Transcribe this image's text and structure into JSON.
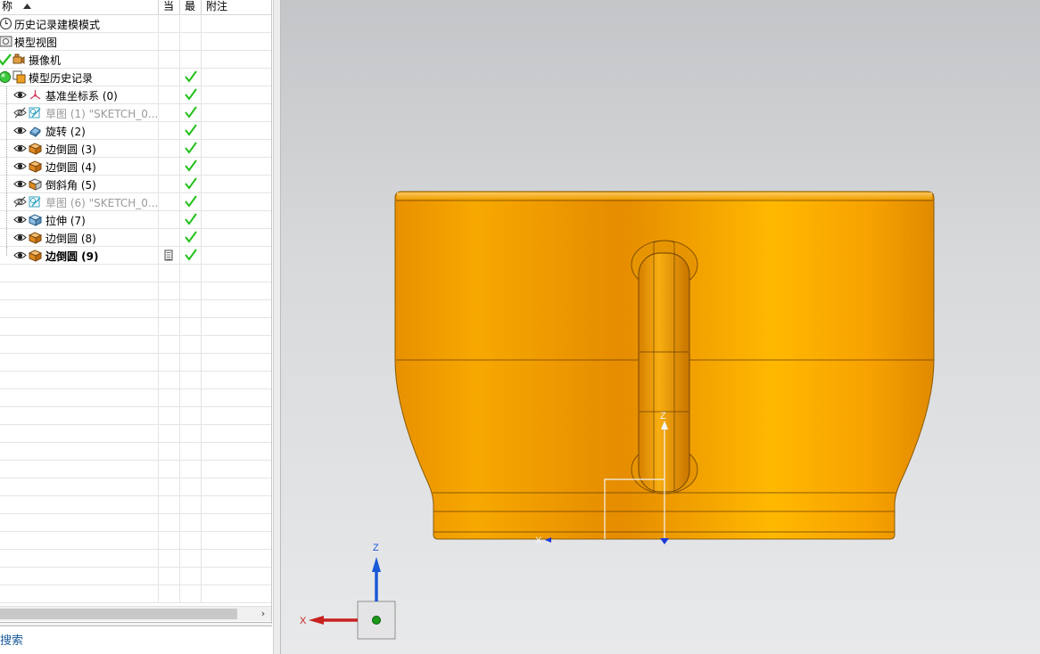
{
  "navigator": {
    "columns": {
      "name": "称",
      "current": "当",
      "latest": "最",
      "notes": "附注"
    },
    "rows": [
      {
        "label": "历史记录建模模式",
        "icon": "clock-icon"
      },
      {
        "label": "模型视图",
        "icon": "model-view-icon"
      },
      {
        "label": "摄像机",
        "icon": "camera-icon"
      },
      {
        "label": "模型历史记录",
        "icon": "history-folder-icon"
      },
      {
        "label": "基准坐标系 (0)",
        "icon": "datum-csys-icon"
      },
      {
        "label": "草图 (1) \"SKETCH_0...",
        "icon": "sketch-icon"
      },
      {
        "label": "旋转 (2)",
        "icon": "revolve-icon"
      },
      {
        "label": "边倒圆 (3)",
        "icon": "edge-blend-icon"
      },
      {
        "label": "边倒圆 (4)",
        "icon": "edge-blend-icon"
      },
      {
        "label": "倒斜角 (5)",
        "icon": "chamfer-icon"
      },
      {
        "label": "草图 (6) \"SKETCH_0...",
        "icon": "sketch-icon"
      },
      {
        "label": "拉伸 (7)",
        "icon": "extrude-icon"
      },
      {
        "label": "边倒圆 (8)",
        "icon": "edge-blend-icon"
      },
      {
        "label": "边倒圆 (9)",
        "icon": "edge-blend-icon"
      }
    ],
    "search_label": "搜索",
    "scroll_right": "›"
  },
  "viewport": {
    "triad": {
      "z_label": "Z",
      "x_label": "X"
    },
    "wcs": {
      "z_label": "Z",
      "x_label": "X"
    }
  },
  "colors": {
    "model_orange": "#f5a300",
    "check_green": "#22c01a",
    "triad_blue": "#1a5ad8",
    "triad_red": "#c82020"
  }
}
